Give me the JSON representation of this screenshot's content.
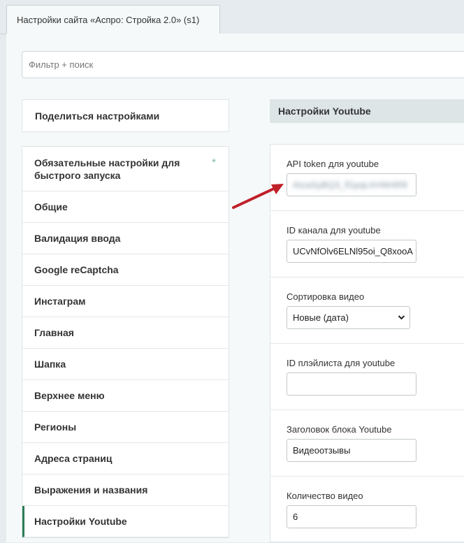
{
  "tab": {
    "title": "Настройки сайта «Аспро: Стройка 2.0» (s1)"
  },
  "filter": {
    "placeholder": "Фильтр + поиск"
  },
  "share_label": "Поделиться настройками",
  "menu": {
    "items": [
      {
        "label": "Обязательные настройки для быстрого запуска"
      },
      {
        "label": "Общие"
      },
      {
        "label": "Валидация ввода"
      },
      {
        "label": "Google reCaptcha"
      },
      {
        "label": "Инстаграм"
      },
      {
        "label": "Главная"
      },
      {
        "label": "Шапка"
      },
      {
        "label": "Верхнее меню"
      },
      {
        "label": "Регионы"
      },
      {
        "label": "Адреса страниц"
      },
      {
        "label": "Выражения и названия"
      },
      {
        "label": "Настройки Youtube"
      }
    ],
    "required_marker": "*"
  },
  "section": {
    "title": "Настройки Youtube"
  },
  "fields": {
    "api_token": {
      "label": "API token для youtube",
      "value": "AIzaSyBQ3_fGpqLKHW4R8"
    },
    "channel_id": {
      "label": "ID канала для youtube",
      "value": "UCvNfOlv6ELNl95oi_Q8xooA"
    },
    "sort": {
      "label": "Сортировка видео",
      "value": "Новые (дата)"
    },
    "playlist_id": {
      "label": "ID плэйлиста для youtube",
      "value": ""
    },
    "block_title": {
      "label": "Заголовок блока Youtube",
      "value": "Видеоотзывы"
    },
    "video_count": {
      "label": "Количество видео",
      "value": "6"
    }
  },
  "colors": {
    "annotation_arrow": "#c0202a",
    "active_marker": "#2c7d55"
  }
}
